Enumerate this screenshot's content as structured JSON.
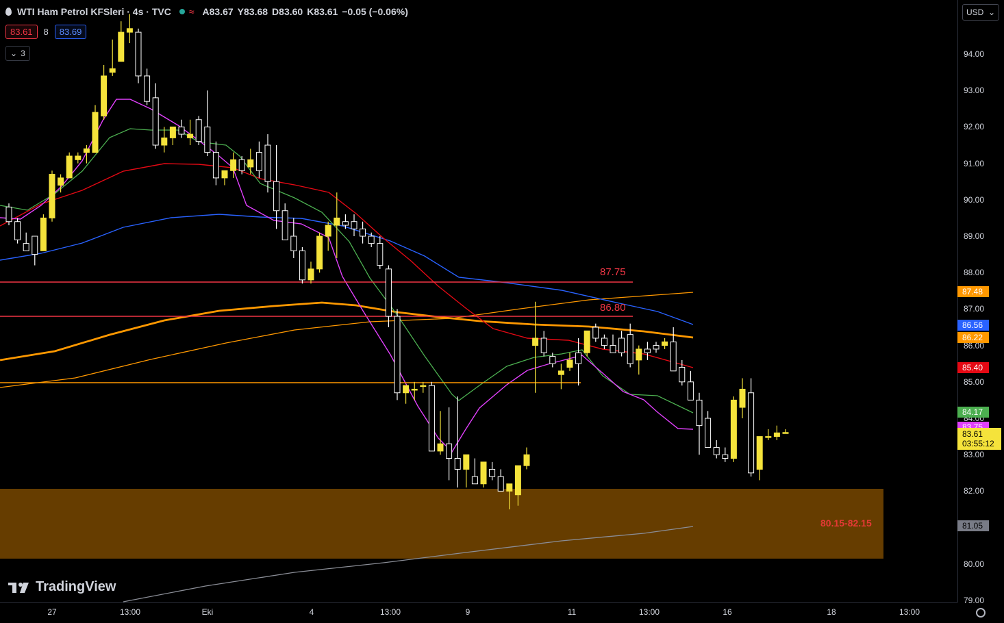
{
  "header": {
    "symbol_title": "WTI Ham Petrol KFSleri · 4s · TVC",
    "wave_glyph": "≈",
    "ohlc": {
      "open": "A83.67",
      "high": "Y83.68",
      "low": "D83.60",
      "close": "K83.61",
      "change": "−0.05 (−0.06%)"
    },
    "bid": "83.61",
    "spread": "8",
    "ask": "83.69",
    "collapse_label": "3",
    "collapse_arrow": "⌄"
  },
  "currency": {
    "label": "USD",
    "arrow": "⌄"
  },
  "price_axis": {
    "ticks": [
      "94.00",
      "93.00",
      "92.00",
      "91.00",
      "90.00",
      "89.00",
      "88.00",
      "87.00",
      "86.00",
      "85.00",
      "84.00",
      "83.00",
      "82.00",
      "81.00",
      "80.00",
      "79.00"
    ],
    "labels": [
      {
        "value": "87.48",
        "color": "#ff9800"
      },
      {
        "value": "86.56",
        "color": "#2962ff"
      },
      {
        "value": "86.22",
        "color": "#ff9800"
      },
      {
        "value": "85.40",
        "color": "#e50914"
      },
      {
        "value": "84.17",
        "color": "#4caf50"
      },
      {
        "value": "83.75",
        "color": "#e040fb"
      },
      {
        "value": "81.05",
        "color": "#787b86"
      }
    ],
    "last_price": "83.61",
    "countdown": "03:55:12"
  },
  "time_axis": {
    "ticks": [
      "27",
      "13:00",
      "Eki",
      "4",
      "13:00",
      "9",
      "11",
      "13:00",
      "16",
      "18",
      "13:00"
    ]
  },
  "annotations": {
    "resistance_1": "87.75",
    "resistance_2": "86.80",
    "zone": "80.15-82.15"
  },
  "logo_text": "TradingView",
  "colors": {
    "candle_up": "#f5e33b",
    "candle_down": "#ffffff",
    "zone": "#663d00",
    "ema_pink": "#e040fb",
    "ema_green": "#4caf50",
    "ema_red": "#e50914",
    "ema_blue": "#2962ff",
    "ema_orange": "#ff9800",
    "hline_red": "#f23645"
  },
  "chart_data": {
    "type": "candlestick",
    "interval": "4s",
    "y_range": [
      79,
      95
    ],
    "candles": [
      [
        89.8,
        89.9,
        89.3,
        89.4
      ],
      [
        89.4,
        89.5,
        88.8,
        88.9
      ],
      [
        88.8,
        89.1,
        88.6,
        88.6
      ],
      [
        89.0,
        89.0,
        88.2,
        88.5
      ],
      [
        88.6,
        89.6,
        88.6,
        89.5
      ],
      [
        89.5,
        90.8,
        89.4,
        90.7
      ],
      [
        90.4,
        90.7,
        90.2,
        90.6
      ],
      [
        90.6,
        91.3,
        90.6,
        91.2
      ],
      [
        91.1,
        91.3,
        91.0,
        91.2
      ],
      [
        91.3,
        91.5,
        91.0,
        91.4
      ],
      [
        91.3,
        92.6,
        91.3,
        92.4
      ],
      [
        92.3,
        93.7,
        92.2,
        93.4
      ],
      [
        93.5,
        94.4,
        93.4,
        93.6
      ],
      [
        93.8,
        94.9,
        93.8,
        94.6
      ],
      [
        94.6,
        95.1,
        94.3,
        94.7
      ],
      [
        94.6,
        94.7,
        93.2,
        93.4
      ],
      [
        93.4,
        93.6,
        92.6,
        92.7
      ],
      [
        92.8,
        93.2,
        91.4,
        91.5
      ],
      [
        91.5,
        92.0,
        91.3,
        91.7
      ],
      [
        91.7,
        92.0,
        91.5,
        92.0
      ],
      [
        92.0,
        92.2,
        91.7,
        91.8
      ],
      [
        91.7,
        92.2,
        91.5,
        91.8
      ],
      [
        92.2,
        92.3,
        91.5,
        91.6
      ],
      [
        92.0,
        93.0,
        91.2,
        91.3
      ],
      [
        91.3,
        91.6,
        90.4,
        90.6
      ],
      [
        90.6,
        90.8,
        90.4,
        90.8
      ],
      [
        90.8,
        91.3,
        90.6,
        91.1
      ],
      [
        91.1,
        91.2,
        90.7,
        90.8
      ],
      [
        90.9,
        91.4,
        90.7,
        91.1
      ],
      [
        91.3,
        91.6,
        90.6,
        90.8
      ],
      [
        91.5,
        91.8,
        90.2,
        90.5
      ],
      [
        90.5,
        91.5,
        89.2,
        89.7
      ],
      [
        89.7,
        89.9,
        88.9,
        88.9
      ],
      [
        89.0,
        89.5,
        88.4,
        88.6
      ],
      [
        88.6,
        88.7,
        87.7,
        87.8
      ],
      [
        87.8,
        88.3,
        87.7,
        88.1
      ],
      [
        88.1,
        89.1,
        88.0,
        89.0
      ],
      [
        89.0,
        89.4,
        88.6,
        89.3
      ],
      [
        89.3,
        90.2,
        88.4,
        89.5
      ],
      [
        89.4,
        89.6,
        89.2,
        89.3
      ],
      [
        89.4,
        89.6,
        89.0,
        89.2
      ],
      [
        89.2,
        89.4,
        88.8,
        89.0
      ],
      [
        89.0,
        89.1,
        88.7,
        88.8
      ],
      [
        88.8,
        89.0,
        88.1,
        88.2
      ],
      [
        88.1,
        88.2,
        86.5,
        86.8
      ],
      [
        86.8,
        87.0,
        84.5,
        84.7
      ],
      [
        84.7,
        84.9,
        84.4,
        84.9
      ],
      [
        84.8,
        85.0,
        84.5,
        84.8
      ],
      [
        84.9,
        85.0,
        84.7,
        84.9
      ],
      [
        84.9,
        85.0,
        83.3,
        83.1
      ],
      [
        83.1,
        84.2,
        83.0,
        83.3
      ],
      [
        83.3,
        84.3,
        82.3,
        82.9
      ],
      [
        82.9,
        84.6,
        82.1,
        82.6
      ],
      [
        82.6,
        83.0,
        82.1,
        83.0
      ],
      [
        82.4,
        82.9,
        82.2,
        82.2
      ],
      [
        82.2,
        82.8,
        82.1,
        82.8
      ],
      [
        82.6,
        82.8,
        82.3,
        82.4
      ],
      [
        82.4,
        82.6,
        82.0,
        82.0
      ],
      [
        82.0,
        82.2,
        81.5,
        82.2
      ],
      [
        81.9,
        82.7,
        81.6,
        82.7
      ],
      [
        82.7,
        83.2,
        82.6,
        83.0
      ],
      [
        86.0,
        87.2,
        84.7,
        86.2
      ],
      [
        86.2,
        86.4,
        85.7,
        85.8
      ],
      [
        85.7,
        85.8,
        85.4,
        85.5
      ],
      [
        85.2,
        85.5,
        84.8,
        85.3
      ],
      [
        85.4,
        85.8,
        85.3,
        85.6
      ],
      [
        85.8,
        86.2,
        84.9,
        85.5
      ],
      [
        85.8,
        86.4,
        85.7,
        86.4
      ],
      [
        86.5,
        86.6,
        86.1,
        86.2
      ],
      [
        86.2,
        86.3,
        85.9,
        86.0
      ],
      [
        86.0,
        86.3,
        85.9,
        85.8
      ],
      [
        86.2,
        86.4,
        85.7,
        85.8
      ],
      [
        86.3,
        86.6,
        85.4,
        85.5
      ],
      [
        85.6,
        86.0,
        85.2,
        85.9
      ],
      [
        85.9,
        86.1,
        85.6,
        85.8
      ],
      [
        86.0,
        86.1,
        85.8,
        85.9
      ],
      [
        86.0,
        86.2,
        85.9,
        86.1
      ],
      [
        86.1,
        86.5,
        85.9,
        85.3
      ],
      [
        85.4,
        85.6,
        84.9,
        85.0
      ],
      [
        85.0,
        85.3,
        84.5,
        84.5
      ],
      [
        84.5,
        84.7,
        83.0,
        83.8
      ],
      [
        84.0,
        84.2,
        83.3,
        83.2
      ],
      [
        83.2,
        83.4,
        82.9,
        83.0
      ],
      [
        83.0,
        83.2,
        82.8,
        82.9
      ],
      [
        82.9,
        84.6,
        82.8,
        84.5
      ],
      [
        84.3,
        85.1,
        84.0,
        84.8
      ],
      [
        84.7,
        85.1,
        82.4,
        82.5
      ],
      [
        82.6,
        83.5,
        82.3,
        83.5
      ],
      [
        83.5,
        83.7,
        83.4,
        83.5
      ],
      [
        83.5,
        83.8,
        83.4,
        83.6
      ],
      [
        83.6,
        83.7,
        83.6,
        83.61
      ]
    ]
  }
}
